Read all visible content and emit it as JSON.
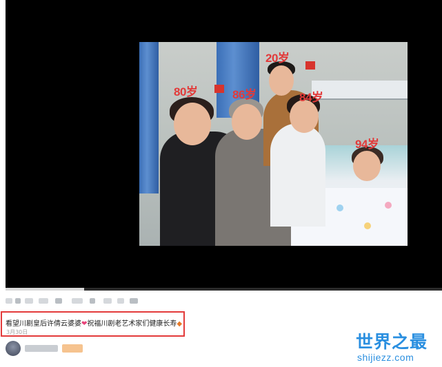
{
  "photo": {
    "age_labels": [
      "80岁",
      "86岁",
      "20岁",
      "84岁",
      "94岁"
    ]
  },
  "video": {
    "progress_fraction": 0.18
  },
  "post": {
    "caption_part1": "看望川剧皇后许倩云婆婆",
    "heart_glyph": "❤",
    "caption_part2": "祝福川剧老艺术家们健康长寿",
    "diamond_glyph": "◆",
    "date": "3月30日"
  },
  "watermark": {
    "title": "世界之最",
    "url": "shijiezz.com",
    "color": "#2a8fe0"
  },
  "colors": {
    "highlight_border": "#e33a3a",
    "age_label": "#e23a3a"
  }
}
